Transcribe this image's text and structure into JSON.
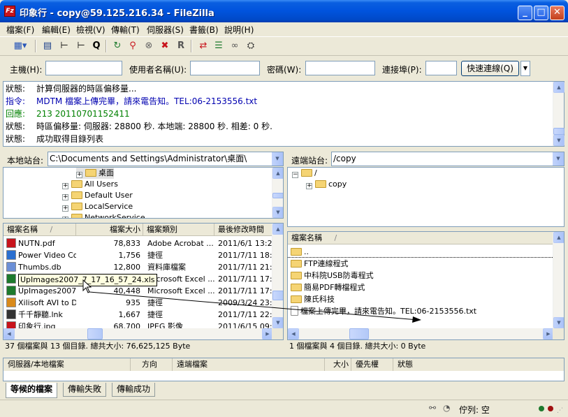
{
  "titlebar": {
    "app_icon": "Fz",
    "title": "印象行 - copy@59.125.216.34 - FileZilla",
    "minimize_icon": "minimize-icon",
    "maximize_icon": "maximize-icon",
    "close_icon": "close-icon"
  },
  "menu": [
    "檔案(F)",
    "編輯(E)",
    "檢視(V)",
    "傳輸(T)",
    "伺服器(S)",
    "書籤(B)",
    "說明(H)"
  ],
  "quickconnect": {
    "host_label": "主機(H):",
    "user_label": "使用者名稱(U):",
    "pass_label": "密碼(W):",
    "port_label": "連接埠(P):",
    "host_value": "",
    "user_value": "",
    "pass_value": "",
    "port_value": "",
    "button_label": "快速連線(Q)"
  },
  "log": [
    {
      "type": "狀態:",
      "text": "計算伺服器的時區偏移量...",
      "kind": "status"
    },
    {
      "type": "指令:",
      "text": "MDTM 檔案上傳完畢，請來電告知。TEL:06-2153556.txt",
      "kind": "command"
    },
    {
      "type": "回應:",
      "text": "213 20110701152411",
      "kind": "response"
    },
    {
      "type": "狀態:",
      "text": "時區偏移量: 伺服器: 28800 秒. 本地端: 28800 秒. 相差: 0 秒.",
      "kind": "status"
    },
    {
      "type": "狀態:",
      "text": "成功取得目錄列表",
      "kind": "status"
    }
  ],
  "local": {
    "site_label": "本地站台:",
    "path": "C:\\Documents and Settings\\Administrator\\桌面\\",
    "tree": [
      {
        "label": "桌面",
        "indent": 1,
        "selected": true
      },
      {
        "label": "All Users",
        "indent": 0
      },
      {
        "label": "Default User",
        "indent": 0
      },
      {
        "label": "LocalService",
        "indent": 0
      },
      {
        "label": "NetworkService",
        "indent": 0
      }
    ],
    "columns": [
      "檔案名稱",
      "檔案大小",
      "檔案類別",
      "最後修改時間"
    ],
    "sort_indicator": "/",
    "files": [
      {
        "name": "NUTN.pdf",
        "size": "78,833",
        "type": "Adobe Acrobat ...",
        "modified": "2011/6/1 13:28",
        "icon": "pdf-icon",
        "color": "#c8141c"
      },
      {
        "name": "Power Video Con...",
        "size": "1,756",
        "type": "捷徑",
        "modified": "2011/7/11 18:3",
        "icon": "shortcut-icon",
        "color": "#2a6fd0"
      },
      {
        "name": "Thumbs.db",
        "size": "12,800",
        "type": "資料庫檔案",
        "modified": "2011/7/11 21:5",
        "icon": "database-icon",
        "color": "#6b8fd6"
      },
      {
        "name": "UpImages2007_7_...",
        "size": "69,632",
        "type": "Microsoft Excel ...",
        "modified": "2011/7/11 17:4",
        "icon": "excel-icon",
        "color": "#1d7a2d"
      },
      {
        "name": "UpImages2007_7...",
        "size": "40,448",
        "type": "Microsoft Excel ...",
        "modified": "2011/7/11 17:4",
        "icon": "excel-icon",
        "color": "#1d7a2d"
      },
      {
        "name": "Xilisoft AVI to DV...",
        "size": "935",
        "type": "捷徑",
        "modified": "2009/3/24 23:0",
        "icon": "shortcut-icon",
        "color": "#d98a1b"
      },
      {
        "name": "千千靜聽.lnk",
        "size": "1,667",
        "type": "捷徑",
        "modified": "2011/7/11 22:0",
        "icon": "shortcut-icon",
        "color": "#333333"
      },
      {
        "name": "印象行.jpg",
        "size": "68,700",
        "type": "JPEG 影像",
        "modified": "2011/6/15 09:4",
        "icon": "image-icon",
        "color": "#c8141c"
      }
    ],
    "tooltip": "UpImages2007_7_17_16_57_24.xls",
    "summary": "37 個檔案與 13 個目錄. 總共大小: 76,625,125 Byte"
  },
  "remote": {
    "site_label": "遠端站台:",
    "path": "/copy",
    "tree": [
      {
        "label": "/",
        "indent": 0
      },
      {
        "label": "copy",
        "indent": 1
      }
    ],
    "columns": [
      "檔案名稱"
    ],
    "sort_indicator": "/",
    "files": [
      {
        "name": "..",
        "icon": "folder-icon"
      },
      {
        "name": "FTP連線程式",
        "icon": "folder-icon"
      },
      {
        "name": "中科院USB防毒程式",
        "icon": "folder-icon"
      },
      {
        "name": "簡易PDF轉檔程式",
        "icon": "folder-icon"
      },
      {
        "name": "陳氏科技",
        "icon": "folder-icon"
      },
      {
        "name": "檔案上傳完畢，請來電告知。TEL:06-2153556.txt",
        "icon": "text-file-icon"
      }
    ],
    "summary": "1 個檔案與 4 個目錄. 總共大小: 0 Byte"
  },
  "queue": {
    "columns": [
      "伺服器/本地檔案",
      "方向",
      "遠端檔案",
      "大小",
      "優先權",
      "狀態"
    ],
    "tabs": [
      "等候的檔案",
      "傳輸失敗",
      "傳輸成功"
    ]
  },
  "statusbar": {
    "queue_label": "佇列: 空"
  }
}
